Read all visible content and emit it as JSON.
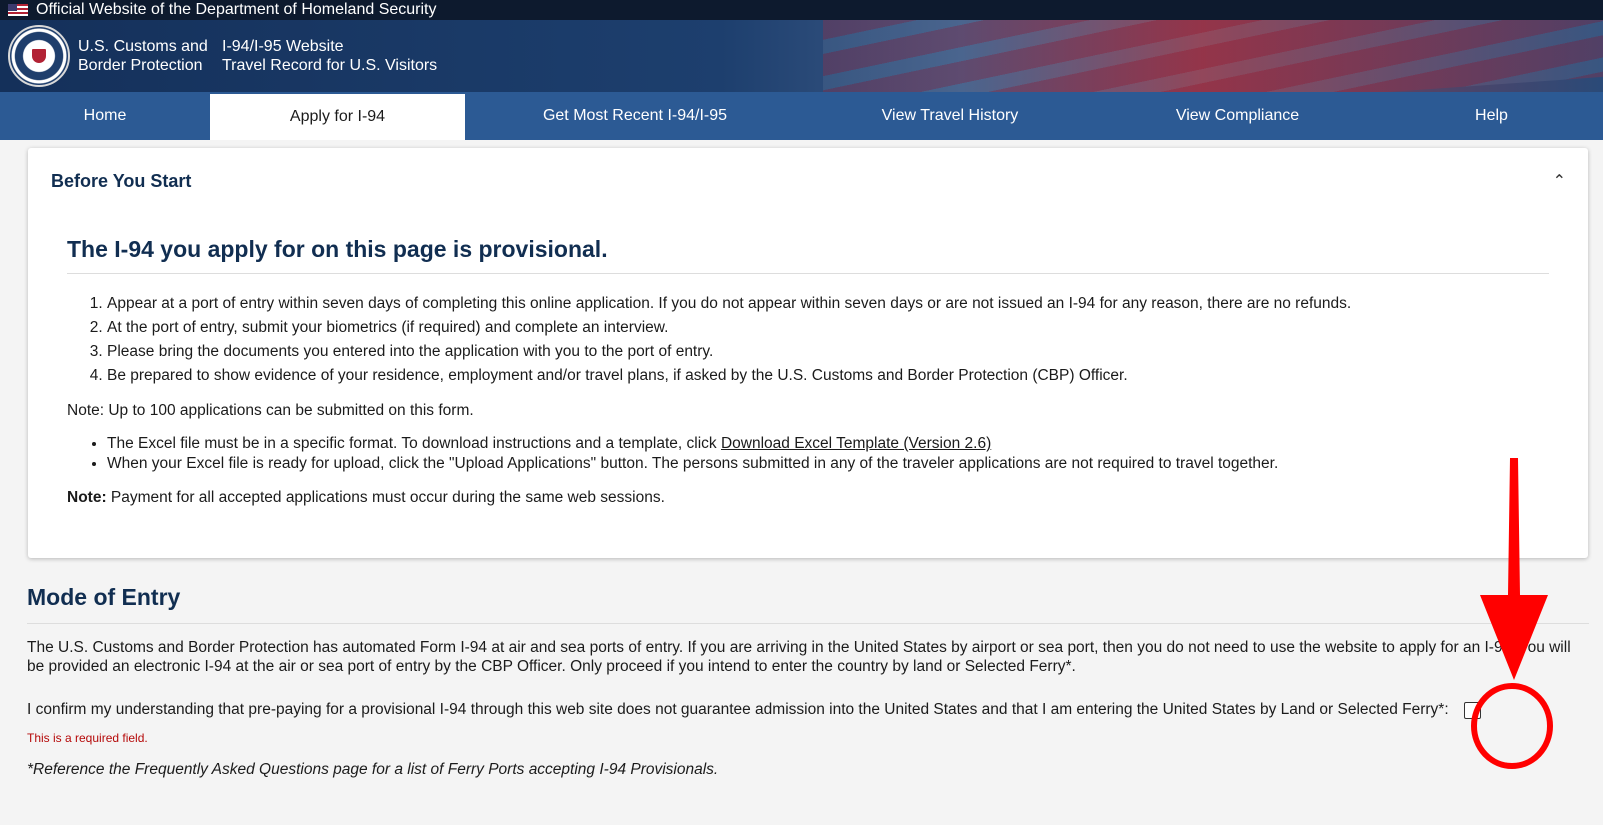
{
  "banner": {
    "text": "Official Website of the Department of Homeland Security"
  },
  "header": {
    "agency_line1": "U.S. Customs and",
    "agency_line2": "Border Protection",
    "site_line1": "I-94/I-95 Website",
    "site_line2": "Travel Record for U.S. Visitors"
  },
  "nav": {
    "items": [
      {
        "label": "Home"
      },
      {
        "label": "Apply for I-94"
      },
      {
        "label": "Get Most Recent I-94/I-95"
      },
      {
        "label": "View Travel History"
      },
      {
        "label": "View Compliance"
      },
      {
        "label": "Help"
      }
    ]
  },
  "before": {
    "title": "Before You Start",
    "heading": "The I-94 you apply for on this page is provisional.",
    "steps": [
      "Appear at a port of entry within seven days of completing this online application. If you do not appear within seven days or are not issued an I-94 for any reason, there are no refunds.",
      "At the port of entry, submit your biometrics (if required) and complete an interview.",
      "Please bring the documents you entered into the application with you to the port of entry.",
      "Be prepared to show evidence of your residence, employment and/or travel plans, if asked by the U.S. Customs and Border Protection (CBP) Officer."
    ],
    "note": "Note: Up to 100 applications can be submitted on this form.",
    "bullet1_text": "The Excel file must be in a specific format. To download instructions and a template, click ",
    "bullet1_link": "Download Excel Template (Version 2.6)",
    "bullet2_text": "When your Excel file is ready for upload, click the \"Upload Applications\" button. The persons submitted in any of the traveler applications are not required to travel together.",
    "note2_label": "Note:",
    "note2_text": " Payment for all accepted applications must occur during the same web sessions."
  },
  "mode": {
    "title": "Mode of Entry",
    "text": "The U.S. Customs and Border Protection has automated Form I-94 at air and sea ports of entry. If you are arriving in the United States by airport or sea port, then you do not need to use the website to apply for an I-94; you will be provided an electronic I-94 at the air or sea port of entry by the CBP Officer. Only proceed if you intend to enter the country by land or Selected Ferry*.",
    "confirm_label": "I confirm my understanding that pre-paying for a provisional I-94 through this web site does not guarantee admission into the United States and that I am entering the United States by Land or Selected Ferry*:",
    "required": "This is a required field.",
    "reference": "*Reference the Frequently Asked Questions page for a list of Ferry Ports accepting I-94 Provisionals."
  },
  "colors": {
    "primary": "#112e51",
    "nav": "#2c5a94",
    "annotation": "#ff0000",
    "error": "#b50909"
  },
  "icons": {
    "flag": "us-flag-icon",
    "seal": "dhs-seal-icon",
    "collapse": "chevron-up-icon"
  }
}
